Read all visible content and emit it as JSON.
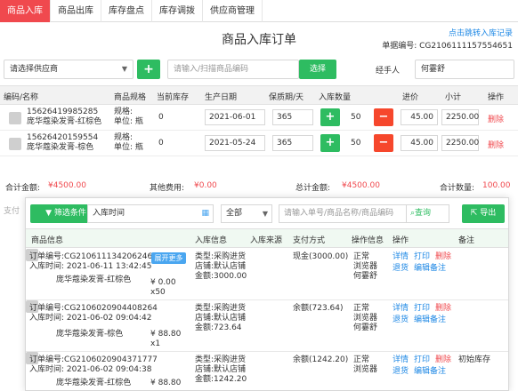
{
  "tabs": [
    "商品入库",
    "商品出库",
    "库存盘点",
    "库存调拨",
    "供应商管理"
  ],
  "page_title": "商品入库订单",
  "jump_link": "点击跳转入库记录",
  "order_no": "单据编号: CG2106111157554651",
  "supplier_select": "请选择供应商",
  "add_button": "+",
  "scan_placeholder": "请输入/扫描商品编码",
  "select_button": "选择",
  "handler_label": "经手人",
  "handler_value": "何霎舒",
  "product_table": {
    "headers": [
      "编码/名称",
      "商品规格",
      "当前库存",
      "生产日期",
      "保质期/天",
      "入库数量",
      "进价",
      "小计",
      "操作"
    ],
    "rows": [
      {
        "code": "15626419985285",
        "name": "庞华蔻染发膏-红棕色",
        "spec1": "规格:",
        "spec2": "单位: 瓶",
        "stock": "0",
        "date": "2021-06-01",
        "shelf": "365",
        "qty": "50",
        "price": "45.00",
        "subtotal": "2250.00",
        "action": "删除"
      },
      {
        "code": "15626420159554",
        "name": "庞华蔻染发膏-棕色",
        "spec1": "规格:",
        "spec2": "单位: 瓶",
        "stock": "0",
        "date": "2021-05-24",
        "shelf": "365",
        "qty": "50",
        "price": "45.00",
        "subtotal": "2250.00",
        "action": "删除"
      }
    ]
  },
  "totals": {
    "total_label": "合计金额:",
    "total_value": "¥4500.00",
    "other_label": "其他费用:",
    "other_value": "¥0.00",
    "grand_label": "总计金额:",
    "grand_value": "¥4500.00",
    "count_label": "合计数量:",
    "count_value": "100.00"
  },
  "pay_label": "支付",
  "panel": {
    "filter_button": "筛选条件",
    "time_label": "入库时间",
    "all_select": "全部",
    "search_placeholder": "请输入单号/商品名称/商品编码",
    "query_button": "查询",
    "export_button": "导出",
    "headers": [
      "商品信息",
      "入库信息",
      "入库来源",
      "支付方式",
      "操作信息",
      "操作",
      "备注"
    ],
    "records": [
      {
        "order": "订单编号:CG2106111342062460",
        "time": "入库时间: 2021-06-11 13:42:45",
        "badge": "展开更多",
        "product": "庞华蔻染发膏-红棕色",
        "price": "¥ 0.00",
        "qty": "x50",
        "info1": "类型:采购进货",
        "info2": "店铺:默认店铺",
        "info3": "金额:3000.00",
        "pay": "现金(3000.00)",
        "op1": "正常",
        "op2": "浏览器",
        "op3": "何霎舒",
        "actions1": [
          "详情",
          "打印",
          "删除"
        ],
        "actions2": [
          "退货",
          "编辑备注"
        ],
        "note": ""
      },
      {
        "order": "订单编号:CG2106020904408264",
        "time": "入库时间: 2021-06-02 09:04:42",
        "badge": "",
        "product": "庞华蔻染发膏-棕色",
        "price": "¥ 88.80",
        "qty": "x1",
        "info1": "类型:采购进货",
        "info2": "店铺:默认店铺",
        "info3": "金额:723.64",
        "pay": "余额(723.64)",
        "op1": "正常",
        "op2": "浏览器",
        "op3": "何霎舒",
        "actions1": [
          "详情",
          "打印",
          "删除"
        ],
        "actions2": [
          "退货",
          "编辑备注"
        ],
        "note": ""
      },
      {
        "order": "订单编号:CG2106020904371777",
        "time": "入库时间: 2021-06-02 09:04:38",
        "badge": "",
        "product": "庞华蔻染发膏-红棕色",
        "price": "¥ 88.80",
        "qty": "",
        "info1": "类型:采购进货",
        "info2": "店铺:默认店铺",
        "info3": "金额:1242.20",
        "pay": "余额(1242.20)",
        "op1": "正常",
        "op2": "浏览器",
        "op3": "",
        "actions1": [
          "详情",
          "打印",
          "删除"
        ],
        "actions2": [
          "退货",
          "编辑备注"
        ],
        "note": "初始库存"
      }
    ]
  },
  "colors": {
    "accent_red": "#f0494e",
    "green": "#2ebc61",
    "blue": "#1e88e5"
  }
}
